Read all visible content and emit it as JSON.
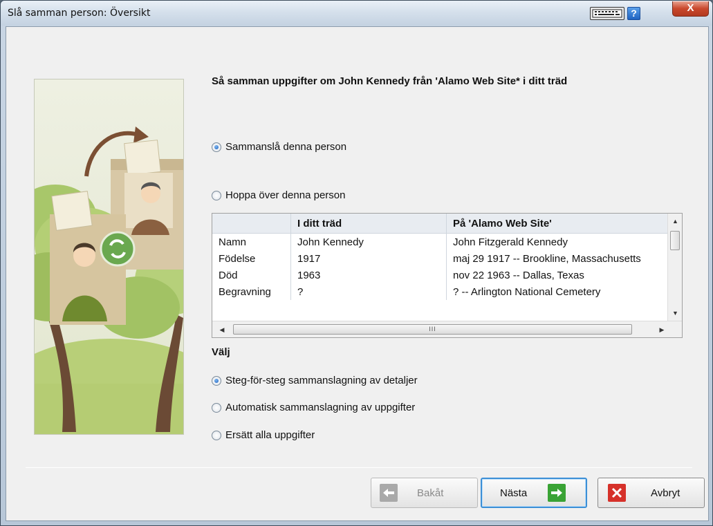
{
  "window": {
    "title": "Slå samman person: Översikt",
    "help_label": "?",
    "close_label": "X"
  },
  "heading": "Så samman uppgifter om John Kennedy från 'Alamo Web Site* i ditt träd",
  "merge_options": [
    {
      "label": "Sammanslå denna person",
      "checked": true
    },
    {
      "label": "Hoppa över denna person",
      "checked": false
    }
  ],
  "table": {
    "columns": [
      "",
      "I ditt träd",
      "På 'Alamo Web Site'"
    ],
    "rows": [
      [
        "Namn",
        "John Kennedy",
        "John Fitzgerald Kennedy"
      ],
      [
        "Födelse",
        "1917",
        "maj 29 1917 -- Brookline, Massachusetts"
      ],
      [
        "Död",
        "1963",
        "nov 22 1963 -- Dallas, Texas"
      ],
      [
        "Begravning",
        "?",
        "? -- Arlington National Cemetery"
      ]
    ],
    "hscroll_grip": "III"
  },
  "choose": {
    "label": "Välj",
    "options": [
      {
        "label": "Steg-för-steg sammanslagning av detaljer",
        "checked": true
      },
      {
        "label": "Automatisk sammanslagning av uppgifter",
        "checked": false
      },
      {
        "label": "Ersätt alla uppgifter",
        "checked": false
      }
    ]
  },
  "buttons": {
    "back": "Bakåt",
    "next": "Nästa",
    "cancel": "Avbryt"
  },
  "colors": {
    "next_icon": "#3aa335",
    "cancel_icon": "#d6312a",
    "back_icon": "#a9a9a9",
    "accent": "#3c8fd6"
  }
}
